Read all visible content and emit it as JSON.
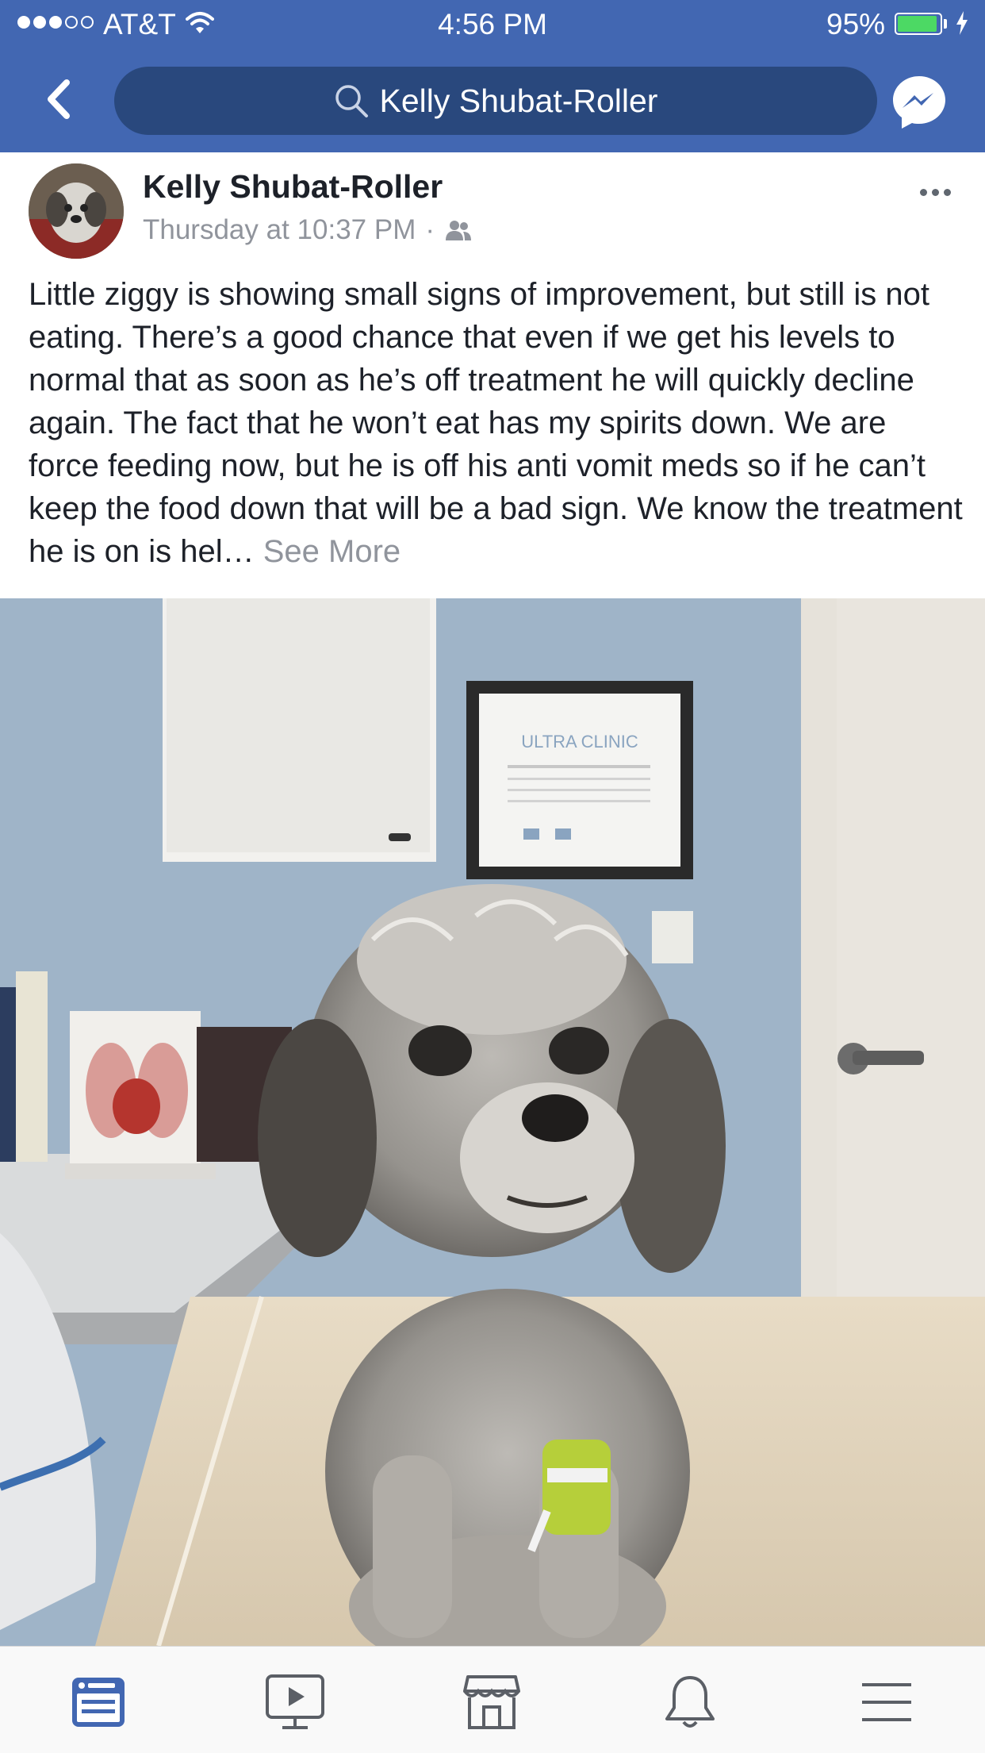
{
  "status_bar": {
    "carrier": "AT&T",
    "time": "4:56 PM",
    "battery": "95%",
    "signal_bars_filled": 3,
    "signal_bars_total": 5,
    "battery_level": 0.95
  },
  "nav": {
    "search_text": "Kelly Shubat-Roller"
  },
  "post": {
    "author": "Kelly Shubat-Roller",
    "timestamp": "Thursday at 10:37 PM",
    "separator": "·",
    "privacy_icon": "friends-icon",
    "text": "Little ziggy is showing small signs of improvement, but still is not eating.  There’s a good chance that even if we get his levels to normal that as soon as he’s off treatment he will quickly decline again.  The fact that he won’t eat has my spirits down.  We are force feeding now, but he is off his anti vomit meds so if he can’t keep the food down that will be a bad sign.  We know the treatment he is on is hel…",
    "see_more": "See More",
    "photo_sign": "ULTRA CLINIC"
  },
  "tabs": [
    {
      "icon": "news-feed-icon",
      "active": true
    },
    {
      "icon": "watch-icon",
      "active": false
    },
    {
      "icon": "marketplace-icon",
      "active": false
    },
    {
      "icon": "notifications-icon",
      "active": false
    },
    {
      "icon": "menu-icon",
      "active": false
    }
  ],
  "colors": {
    "brand": "#4267b2",
    "search_bg": "#29487d",
    "active_tab": "#4267b2",
    "inactive_tab": "#5b5f66",
    "secondary_text": "#90949c"
  }
}
